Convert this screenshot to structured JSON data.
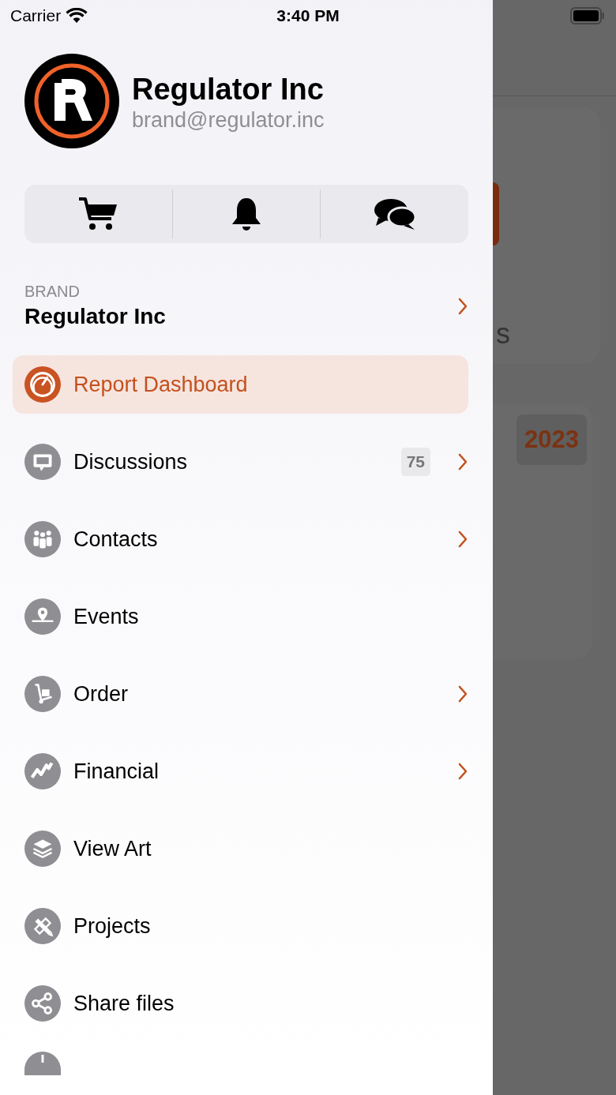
{
  "status_bar": {
    "carrier": "Carrier",
    "time": "3:40 PM"
  },
  "profile": {
    "name": "Regulator Inc",
    "email": "brand@regulator.inc"
  },
  "brand": {
    "caption": "BRAND",
    "name": "Regulator Inc",
    "has_submenu": true
  },
  "menu": [
    {
      "label": "Report Dashboard",
      "selected": true,
      "has_submenu": false
    },
    {
      "label": "Discussions",
      "selected": false,
      "has_submenu": true,
      "badge": "75"
    },
    {
      "label": "Contacts",
      "selected": false,
      "has_submenu": true
    },
    {
      "label": "Events",
      "selected": false,
      "has_submenu": false
    },
    {
      "label": "Order",
      "selected": false,
      "has_submenu": true
    },
    {
      "label": "Financial",
      "selected": false,
      "has_submenu": true
    },
    {
      "label": "View Art",
      "selected": false,
      "has_submenu": false
    },
    {
      "label": "Projects",
      "selected": false,
      "has_submenu": false
    },
    {
      "label": "Share files",
      "selected": false,
      "has_submenu": false
    }
  ],
  "background_screen": {
    "card_text": "s",
    "year_badge": "2023"
  }
}
